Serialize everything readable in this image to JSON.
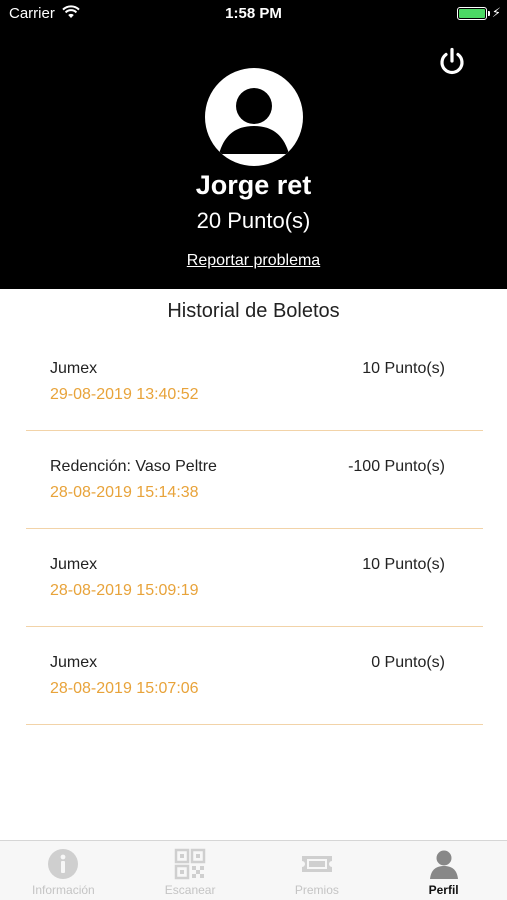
{
  "status_bar": {
    "carrier": "Carrier",
    "time": "1:58 PM"
  },
  "profile": {
    "name": "Jorge ret",
    "points": "20 Punto(s)",
    "report_link": "Reportar problema"
  },
  "history": {
    "title": "Historial de Boletos",
    "items": [
      {
        "name": "Jumex",
        "points": "10 Punto(s)",
        "date": "29-08-2019 13:40:52"
      },
      {
        "name": "Redención: Vaso Peltre",
        "points": "-100 Punto(s)",
        "date": "28-08-2019 15:14:38"
      },
      {
        "name": "Jumex",
        "points": "10 Punto(s)",
        "date": "28-08-2019 15:09:19"
      },
      {
        "name": "Jumex",
        "points": "0 Punto(s)",
        "date": "28-08-2019 15:07:06"
      }
    ]
  },
  "tabbar": {
    "tabs": [
      {
        "label": "Información",
        "icon": "info-icon"
      },
      {
        "label": "Escanear",
        "icon": "qr-code-icon"
      },
      {
        "label": "Premios",
        "icon": "ticket-icon"
      },
      {
        "label": "Perfil",
        "icon": "person-icon"
      }
    ],
    "active": "Perfil"
  },
  "colors": {
    "accent": "#e8a33a",
    "header_bg": "#000000",
    "battery": "#4cd964"
  }
}
